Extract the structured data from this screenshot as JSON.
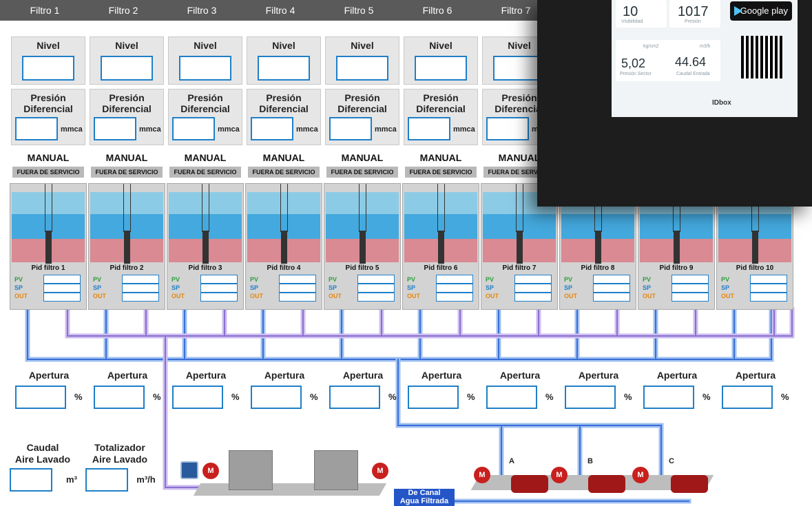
{
  "tabs": [
    "Filtro 1",
    "Filtro 2",
    "Filtro 3",
    "Filtro 4",
    "Filtro 5",
    "Filtro 6",
    "Filtro 7"
  ],
  "filters_top": [
    {
      "nivel": "Nivel",
      "presion": "Presión",
      "diferencial": "Diferencial",
      "unit": "mmca",
      "mode": "MANUAL",
      "status": "FUERA DE SERVICIO"
    },
    {
      "nivel": "Nivel",
      "presion": "Presión",
      "diferencial": "Diferencial",
      "unit": "mmca",
      "mode": "MANUAL",
      "status": "FUERA DE SERVICIO"
    },
    {
      "nivel": "Nivel",
      "presion": "Presión",
      "diferencial": "Diferencial",
      "unit": "mmca",
      "mode": "MANUAL",
      "status": "FUERA DE SERVICIO"
    },
    {
      "nivel": "Nivel",
      "presion": "Presión",
      "diferencial": "Diferencial",
      "unit": "mmca",
      "mode": "MANUAL",
      "status": "FUERA DE SERVICIO"
    },
    {
      "nivel": "Nivel",
      "presion": "Presión",
      "diferencial": "Diferencial",
      "unit": "mmca",
      "mode": "MANUAL",
      "status": "FUERA DE SERVICIO"
    },
    {
      "nivel": "Nivel",
      "presion": "Presión",
      "diferencial": "Diferencial",
      "unit": "mmca",
      "mode": "MANUAL",
      "status": "FUERA DE SERVICIO"
    },
    {
      "nivel": "Nivel",
      "presion": "Presión",
      "diferencial": "Diferencial",
      "unit": "mmca",
      "mode": "MANUAL",
      "status": "FUERA DE SERVICIO"
    }
  ],
  "pid": {
    "labels": [
      "Pid filtro 1",
      "Pid filtro 2",
      "Pid filtro 3",
      "Pid filtro 4",
      "Pid filtro 5",
      "Pid filtro 6",
      "Pid filtro 7",
      "Pid filtro 8",
      "Pid filtro 9",
      "Pid filtro 10"
    ],
    "pv": "PV",
    "sp": "SP",
    "out": "OUT"
  },
  "apertura": {
    "label": "Apertura",
    "unit": "%"
  },
  "caudal": {
    "line1": "Caudal",
    "line2": "Aire Lavado",
    "unit": "m³"
  },
  "totalizador": {
    "line1": "Totalizador",
    "line2": "Aire Lavado",
    "unit": "m³/h"
  },
  "canal": {
    "line1": "De Canal",
    "line2": "Agua Filtrada"
  },
  "valves": [
    "A",
    "B",
    "C"
  ],
  "motor_label": "M",
  "overlay": {
    "visibilidad_value": "10",
    "visibilidad_label": "Visibilidad",
    "presion_value": "1017",
    "presion_label": "Presión",
    "gplay": "Google play",
    "sector_unit": "kg/cm2",
    "sector_value": "5,02",
    "sector_label": "Presión Sector",
    "caudal_unit": "m3/h",
    "caudal_value": "44.64",
    "caudal_label": "Caudal Entrada",
    "brand": "IDbox"
  },
  "colors": {
    "accent": "#1f7fc7",
    "pv": "#2e9e3f",
    "sp": "#1f7fc7",
    "out": "#e8860c",
    "pipe_blue": "#7aa6e8",
    "pipe_purple": "#b9a2e0"
  }
}
